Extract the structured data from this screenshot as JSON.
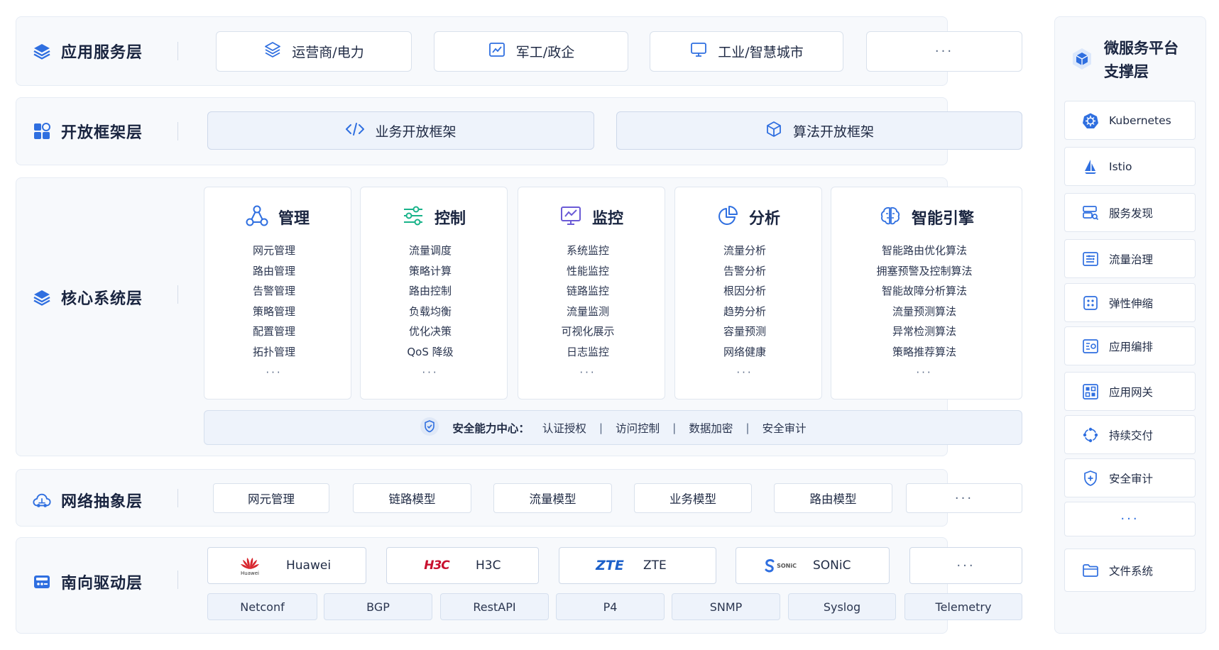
{
  "layers": {
    "app": {
      "title": "应用服务层",
      "items": [
        "运营商/电力",
        "军工/政企",
        "工业/智慧城市"
      ],
      "more": "···"
    },
    "open": {
      "title": "开放框架层",
      "items": [
        "业务开放框架",
        "算法开放框架"
      ]
    },
    "core": {
      "title": "核心系统层",
      "columns": [
        {
          "title": "管理",
          "items": [
            "网元管理",
            "路由管理",
            "告警管理",
            "策略管理",
            "配置管理",
            "拓扑管理"
          ],
          "more": "···"
        },
        {
          "title": "控制",
          "items": [
            "流量调度",
            "策略计算",
            "路由控制",
            "负载均衡",
            "优化决策",
            "QoS 降级"
          ],
          "more": "···"
        },
        {
          "title": "监控",
          "items": [
            "系统监控",
            "性能监控",
            "链路监控",
            "流量监测",
            "可视化展示",
            "日志监控"
          ],
          "more": "···"
        },
        {
          "title": "分析",
          "items": [
            "流量分析",
            "告警分析",
            "根因分析",
            "趋势分析",
            "容量预测",
            "网络健康"
          ],
          "more": "···"
        },
        {
          "title": "智能引擎",
          "items": [
            "智能路由优化算法",
            "拥塞预警及控制算法",
            "智能故障分析算法",
            "流量预测算法",
            "异常检测算法",
            "策略推荐算法"
          ],
          "more": "···"
        }
      ],
      "security": {
        "label": "安全能力中心：",
        "items": [
          "认证授权",
          "访问控制",
          "数据加密",
          "安全审计"
        ],
        "separator": "|"
      }
    },
    "net": {
      "title": "网络抽象层",
      "items": [
        "网元管理",
        "链路模型",
        "流量模型",
        "业务模型",
        "路由模型"
      ],
      "more": "···"
    },
    "south": {
      "title": "南向驱动层",
      "vendors": [
        {
          "logo_text": "Huawei",
          "name": "Huawei"
        },
        {
          "logo_text": "H3C",
          "name": "H3C"
        },
        {
          "logo_text": "ZTE",
          "name": "ZTE"
        },
        {
          "logo_text": "SONiC",
          "name": "SONiC"
        }
      ],
      "more": "···",
      "protocols": [
        "Netconf",
        "BGP",
        "RestAPI",
        "P4",
        "SNMP",
        "Syslog",
        "Telemetry"
      ]
    }
  },
  "sidebar": {
    "title_line1": "微服务平台",
    "title_line2": "支撑层",
    "items": [
      "Kubernetes",
      "Istio",
      "服务发现",
      "流量治理",
      "弹性伸缩",
      "应用编排",
      "应用网关",
      "持续交付",
      "安全审计"
    ],
    "more": "···",
    "bottom": "文件系统"
  },
  "colors": {
    "accent": "#2f6fe0",
    "panel_bg": "#f7f9fc",
    "tint_bg": "#eef3fb",
    "text": "#1f2a44",
    "huawei_red": "#d8262e",
    "h3c_red": "#c8102e",
    "zte_blue": "#1b5fc9"
  }
}
